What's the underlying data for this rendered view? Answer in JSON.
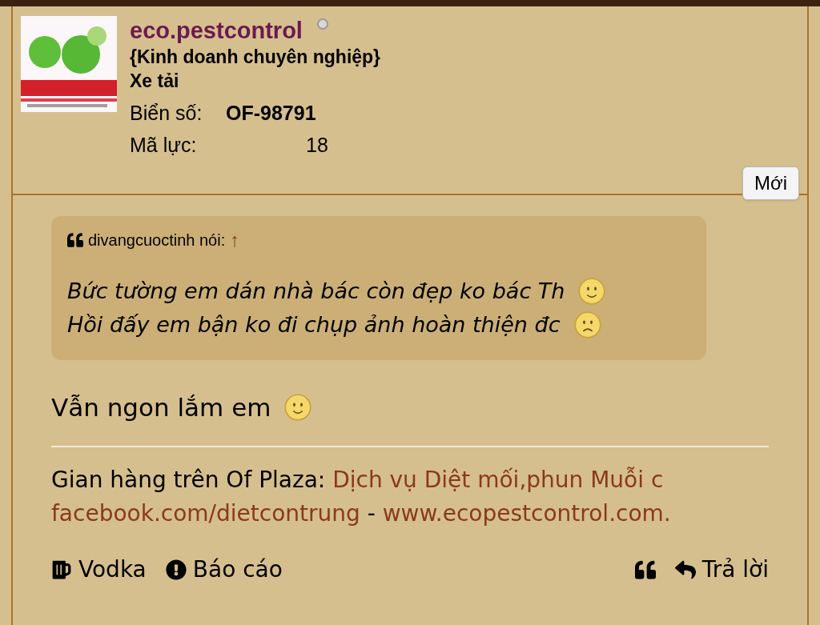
{
  "profile": {
    "username": "eco.pestcontrol",
    "title": "{Kinh doanh chuyên nghiệp}",
    "rank": "Xe tải",
    "fields": [
      {
        "label": "Biển số:",
        "value": "OF-98791",
        "kind": "bold"
      },
      {
        "label": "Mã lực:",
        "value": "18",
        "kind": "plain"
      }
    ],
    "new_badge": "Mới"
  },
  "quote": {
    "author": "divangcuoctinh nói:",
    "arrow": "↑",
    "lines": [
      {
        "text": "Bức tường em dán nhà bác còn đẹp ko bác Th",
        "kind": "smile"
      },
      {
        "text": "Hồi đấy em bận ko đi chụp ảnh hoàn thiện đc",
        "kind": "frown"
      }
    ]
  },
  "message": {
    "text": "Vẫn ngon lắm em",
    "kind": "smile"
  },
  "signature": {
    "lines": [
      [
        {
          "text": "Gian hàng trên Of Plaza: ",
          "link": false
        },
        {
          "text": "Dịch vụ Diệt mối,phun Muỗi c",
          "link": true
        }
      ],
      [
        {
          "text": "facebook.com/dietcontrung",
          "link": true
        },
        {
          "text": " - ",
          "link": false
        },
        {
          "text": "www.ecopestcontrol.com.",
          "link": true
        }
      ]
    ]
  },
  "actions": {
    "left": [
      {
        "label": "Vodka",
        "kind": "mug"
      },
      {
        "label": "Báo cáo",
        "kind": "report"
      }
    ],
    "right": [
      {
        "kind": "quote"
      },
      {
        "label": "Trả lời",
        "kind": "reply"
      }
    ]
  }
}
